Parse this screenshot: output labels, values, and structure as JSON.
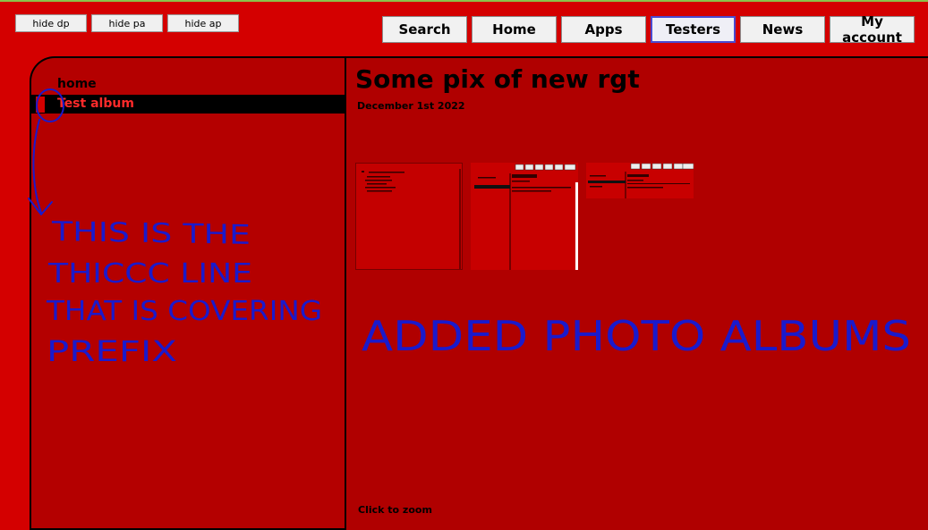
{
  "toolbar": {
    "hide_dp": "hide dp",
    "hide_pa": "hide pa",
    "hide_ap": "hide ap"
  },
  "nav": {
    "search": "Search",
    "home": "Home",
    "apps": "Apps",
    "testers": "Testers",
    "news": "News",
    "account": "My account",
    "active": "Testers"
  },
  "sidebar": {
    "items": [
      {
        "label": "home",
        "active": false
      },
      {
        "label": "Test album",
        "active": true
      }
    ]
  },
  "main": {
    "title": "Some pix of new rgt",
    "date": "December 1st 2022",
    "zoom_hint": "Click to zoom",
    "thumbnail_count": 3
  },
  "annotations": {
    "left_note_lines": [
      "THIS IS THE",
      "THICCC LINE",
      "THAT IS COVERING",
      "PREFIX"
    ],
    "right_note": "ADDED PHOTO ALBUMS",
    "ink_color": "#1a1acc"
  },
  "colors": {
    "page_bg": "#d40000",
    "panel_bg": "#b00000",
    "active_row_bg": "#000000",
    "active_row_text": "#ff2a2a"
  }
}
